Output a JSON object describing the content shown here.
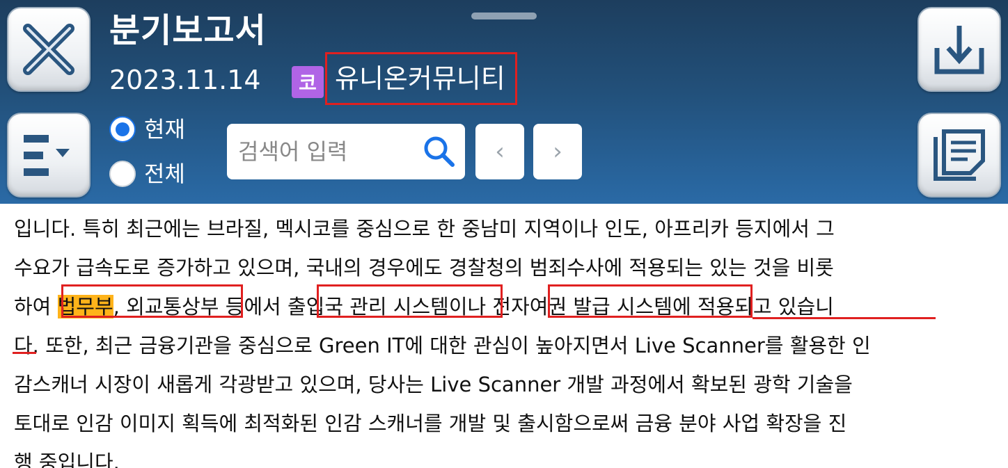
{
  "header": {
    "title": "분기보고서",
    "date": "2023.11.14",
    "company_badge": "코",
    "company_name": "유니온커뮤니티",
    "close_icon": "close-icon",
    "download_icon": "download-icon",
    "menu_icon": "menu-dropdown-icon",
    "document_icon": "document-icon"
  },
  "scope": {
    "options": [
      "현재",
      "전체"
    ],
    "selected": "현재"
  },
  "search": {
    "placeholder": "검색어 입력",
    "value": "",
    "prev_label": "‹",
    "next_label": "›"
  },
  "body": {
    "line1": "입니다. 특히 최근에는 브라질, 멕시코를 중심으로 한 중남미 지역이나 인도, 아프리카 등지에서 그",
    "line2": "수요가 급속도로 증가하고 있으며, 국내의 경우에도 경찰청의 범죄수사에 적용되는 있는 것을 비롯",
    "line3_a": "하여 ",
    "line3_hl": "법무부",
    "line3_b": ", 외교통상부 등에서 출입국 관리 시스템이나 전자여권 발급 시스템에 적용되고 있습니",
    "line4": "다. 또한, 최근 금융기관을 중심으로 Green IT에 대한 관심이 높아지면서 Live Scanner를 활용한 인",
    "line5": "감스캐너 시장이 새롭게 각광받고 있으며, 당사는 Live Scanner 개발 과정에서 확보된 광학 기술을",
    "line6": "토대로 인감 이미지 획득에 최적화된 인감 스캐너를 개발 및 출시함으로써 금융 분야 사업 확장을 진",
    "line7": "행 중입니다."
  },
  "colors": {
    "header_top": "#1d3e5e",
    "header_bottom": "#2a6aa6",
    "highlight": "#ffb31a",
    "annotation_red": "#e02020",
    "badge_purple": "#b064e6",
    "radio_blue": "#1a73e8"
  }
}
